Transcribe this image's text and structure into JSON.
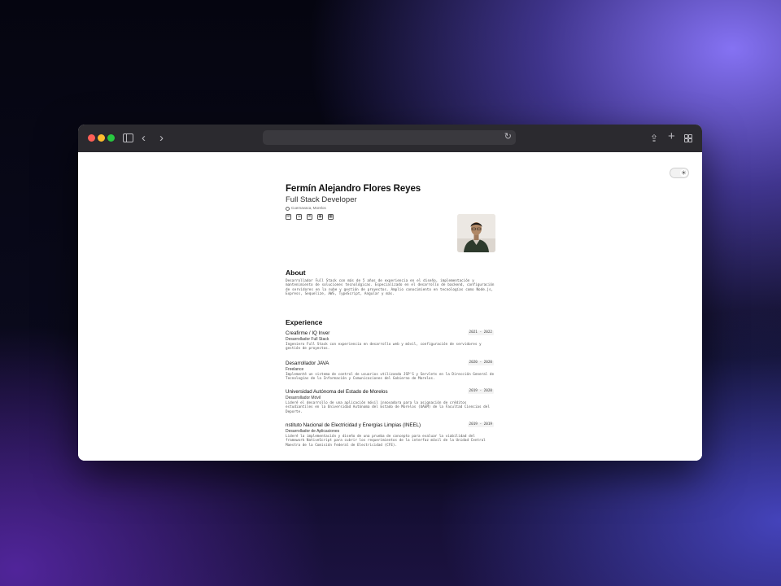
{
  "resume": {
    "name": "Fermín Alejandro Flores Reyes",
    "role": "Full Stack Developer",
    "location": "Cuernavaca, Morelos"
  },
  "contacts": [
    {
      "icon": "mail-icon",
      "glyph": "✉"
    },
    {
      "icon": "phone-icon",
      "glyph": "☏"
    },
    {
      "icon": "linkedin-icon",
      "glyph": "in"
    },
    {
      "icon": "github-icon",
      "glyph": "◉"
    },
    {
      "icon": "qr-icon",
      "glyph": "▦"
    }
  ],
  "about": {
    "title": "About",
    "text": "Desarrollador Full Stack con más de 5 años de experiencia en el diseño, implementación y mantenimiento de soluciones tecnológicas. Especializado en el desarrollo de backend, configuración de servidores en la nube y gestión de proyectos. Amplio conocimiento en tecnologías como Node.js, Express, Sequelize, AWS, TypeScript, Angular y más."
  },
  "experience": {
    "title": "Experience",
    "jobs": [
      {
        "company": "Creafirme / IQ Inver",
        "dates": "2021 - 2022",
        "title": "Desarrollador Full Stack",
        "description": "Ingeniero Full Stack con experiencia en desarrollo web y móvil, configuración de servidores y gestión de proyectos."
      },
      {
        "company": "Desarrollador JAVA",
        "dates": "2020 - 2020",
        "title": "Freelance",
        "description": "Implementé un sistema de control de usuarios utilizando JSP'S y Servlets en la Dirección General de Tecnologías de la Información y Comunicaciones del Gobierno de Morelos."
      },
      {
        "company": "Universidad Autónoma del Estado de Morelos",
        "dates": "2019 - 2020",
        "title": "Desarrollador Móvil",
        "description": "Lideré el desarrollo de una aplicación móvil innovadora para la asignación de créditos estudiantiles en la Universidad Autónoma del Estado de Morelos (UAEM) de la Facultad Ciencias del Deporte."
      },
      {
        "company": "nstituto Nacional de Electricidad y Energías Limpias (INEEL)",
        "dates": "2019 - 2019",
        "title": "Desarrollador de Aplicaciones",
        "description": "Lideré la implementación y diseño de una prueba de concepto para evaluar la viabilidad del framework NativeScript para cubrir los requerimientos de la interfaz móvil de la Unidad Central Maestra de la Comisión Federal de Electricidad (CFE)."
      }
    ]
  }
}
